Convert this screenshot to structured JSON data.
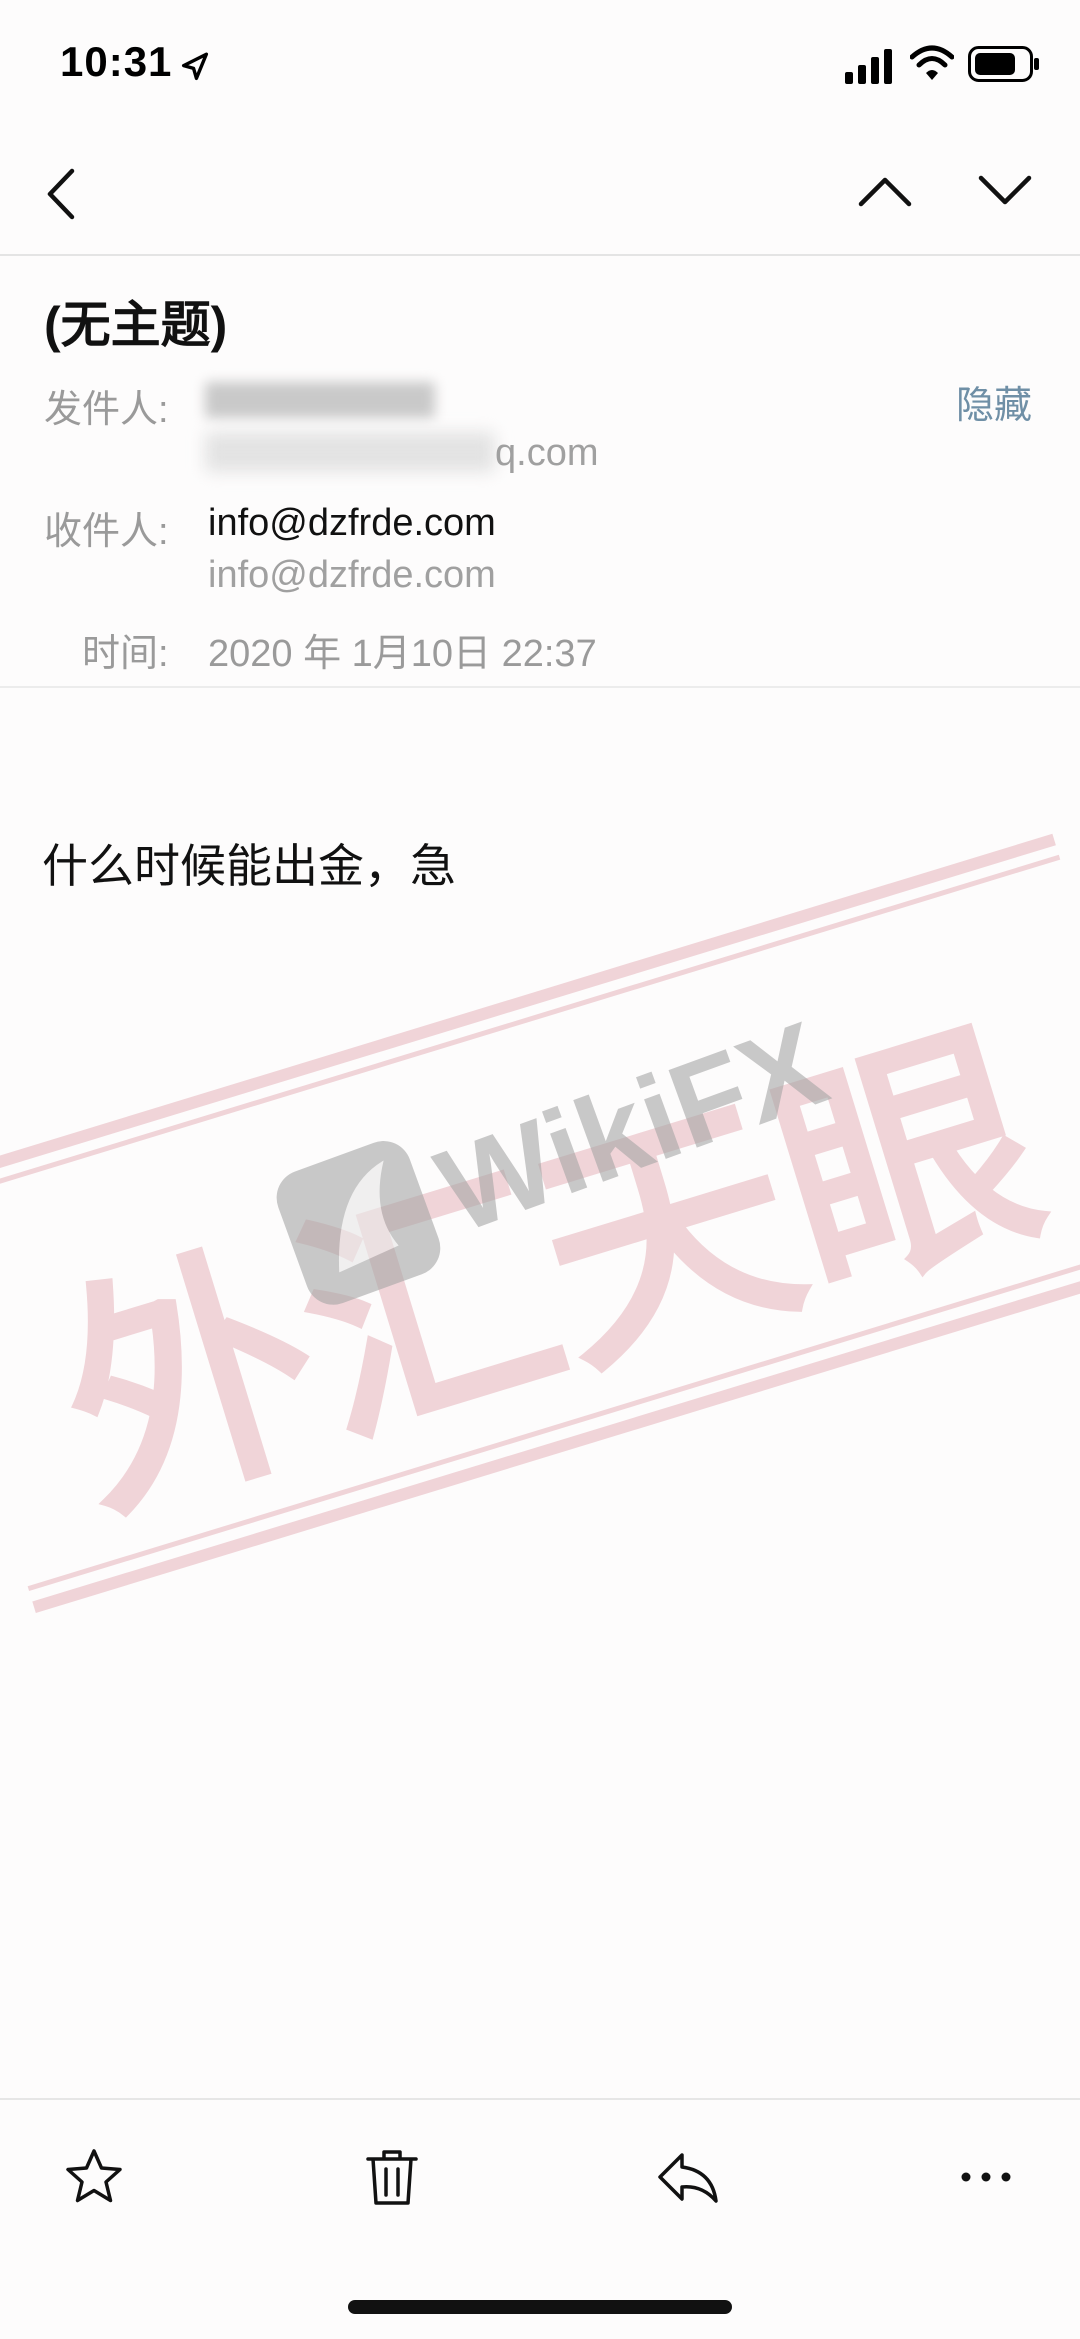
{
  "status_bar": {
    "time": "10:31"
  },
  "header": {
    "subject": "(无主题)",
    "from_label": "发件人:",
    "from_email_tail": "q.com",
    "hide_label": "隐藏",
    "to_label": "收件人:",
    "to_name": "info@dzfrde.com",
    "to_email": "info@dzfrde.com",
    "time_label": "时间:",
    "date": "2020 年 1月10日 22:37"
  },
  "body": {
    "text": "什么时候能出金，急"
  },
  "watermark": {
    "brand": "WikiFX",
    "stamp": "外汇天眼",
    "color": "#e6b4bc"
  },
  "icons": {
    "back": "chevron-left-icon",
    "prev": "chevron-up-icon",
    "next": "chevron-down-icon",
    "star": "star-icon",
    "trash": "trash-icon",
    "reply": "reply-icon",
    "more": "more-icon"
  }
}
